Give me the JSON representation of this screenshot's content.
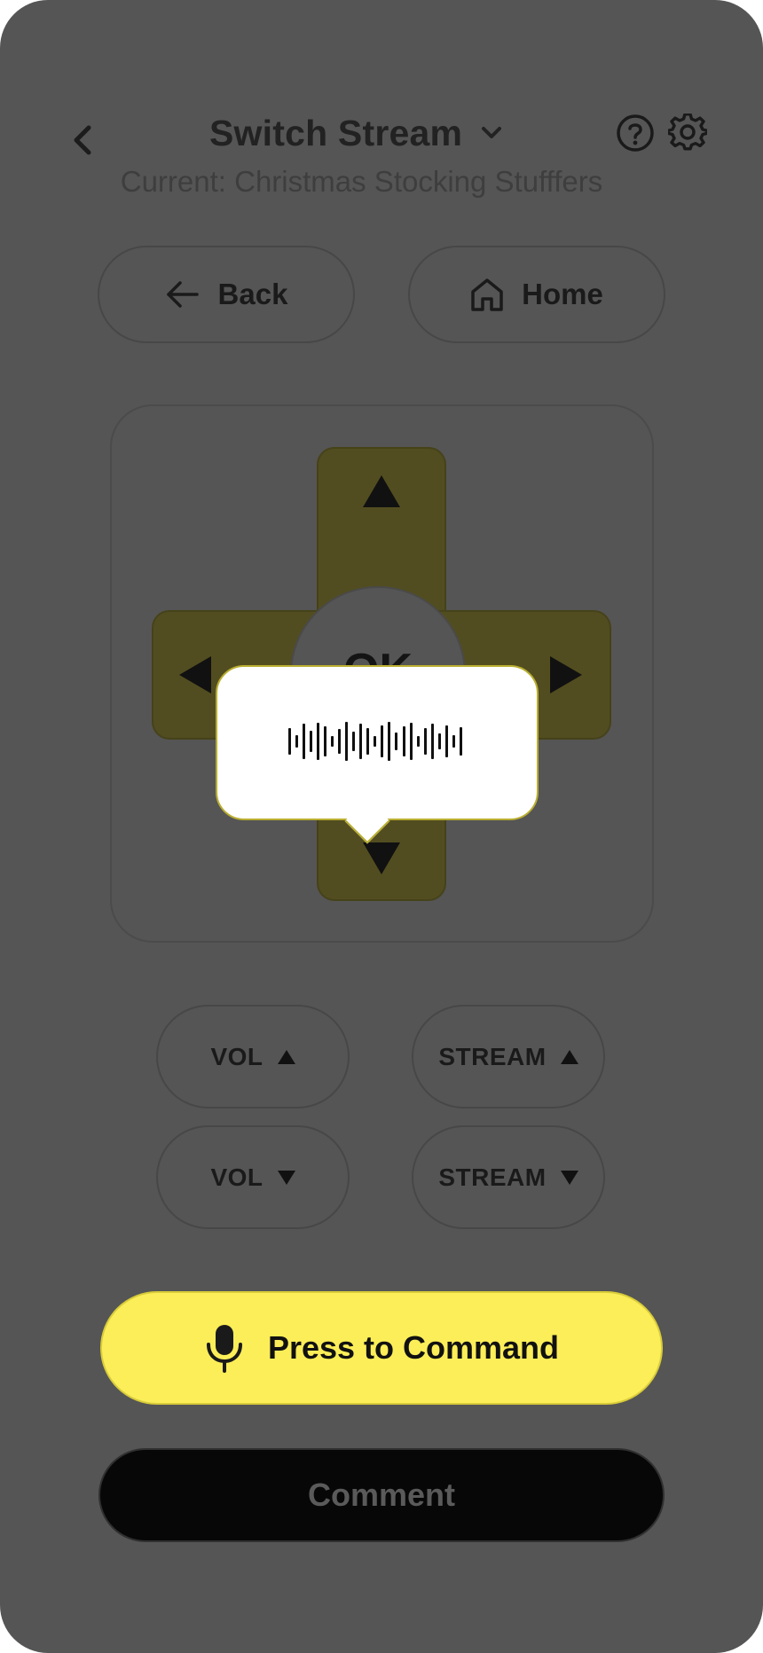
{
  "header": {
    "title": "Switch Stream",
    "current_label": "Current: Christmas Stocking Stufffers",
    "icons": [
      "chevron-left-icon",
      "chevron-down-icon",
      "help-icon",
      "gear-icon"
    ]
  },
  "nav": {
    "back_label": "Back",
    "home_label": "Home"
  },
  "dpad": {
    "ok_label": "OK",
    "accent_color": "#524d20"
  },
  "voice_bubble": {
    "state": "listening"
  },
  "controls": {
    "vol_up": "VOL",
    "stream_up": "STREAM",
    "vol_down": "VOL",
    "stream_down": "STREAM"
  },
  "actions": {
    "press_label": "Press to Command",
    "comment_label": "Comment",
    "press_color": "#fcee58"
  }
}
